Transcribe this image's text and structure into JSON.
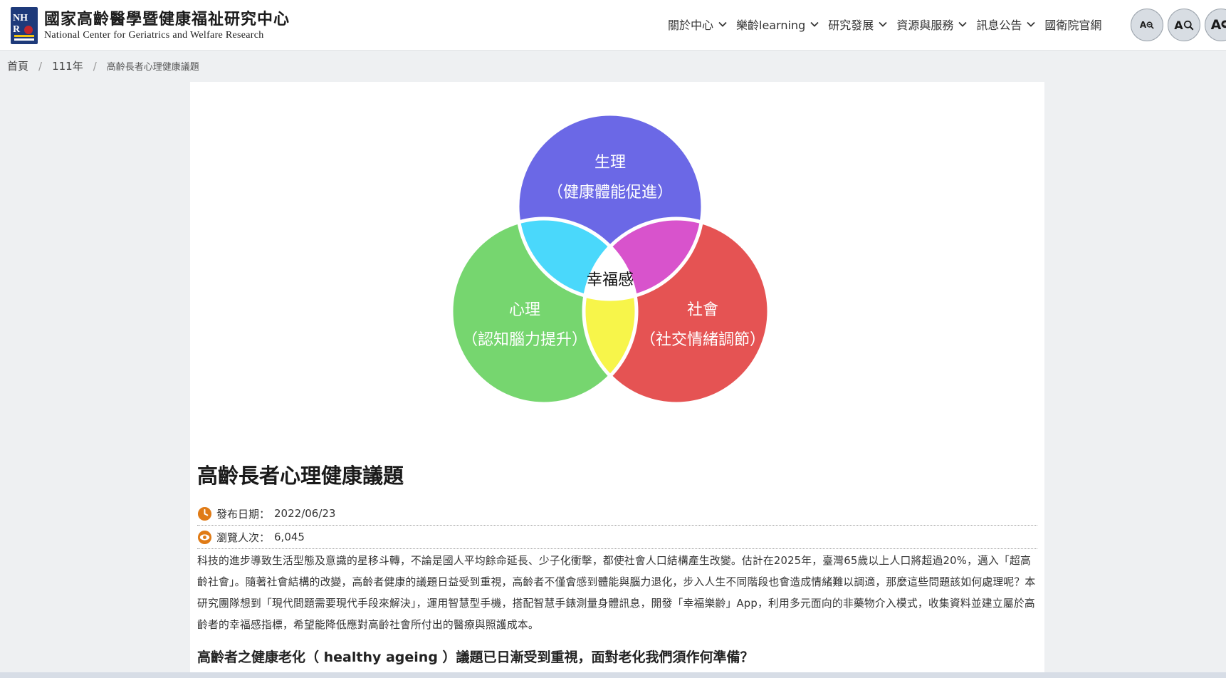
{
  "header": {
    "logo_cn": "國家高齡醫學暨健康福祉研究中心",
    "logo_en": "National Center for Geriatrics and Welfare Research",
    "nav": [
      {
        "label": "關於中心"
      },
      {
        "label": "樂齡learning"
      },
      {
        "label": "研究發展"
      },
      {
        "label": "資源與服務"
      },
      {
        "label": "訊息公告"
      },
      {
        "label": "國衛院官網"
      }
    ],
    "font_buttons": [
      {
        "label": "A",
        "icon": "zoom-out-icon"
      },
      {
        "label": "A",
        "icon": "search-icon"
      },
      {
        "label": "A",
        "icon": "zoom-in-icon"
      }
    ]
  },
  "breadcrumb": {
    "items": [
      "首頁",
      "111年",
      "高齡長者心理健康議題"
    ]
  },
  "venn": {
    "top_title": "生理",
    "top_sub": "（健康體能促進）",
    "left_title": "心理",
    "left_sub": "（認知腦力提升）",
    "right_title": "社會",
    "right_sub": "（社交情緒調節）",
    "center": "幸福感",
    "colors": {
      "top": "#6b68e6",
      "left": "#76d66f",
      "right": "#e55353",
      "top_left": "#4ad8fb",
      "top_right": "#d853cc",
      "left_right": "#f7f54a",
      "center": "#ffffff"
    }
  },
  "article": {
    "title": "高齡長者心理健康議題",
    "date_label": "發布日期：",
    "date_value": "2022/06/23",
    "views_label": "瀏覽人次：",
    "views_value": "6,045",
    "paragraph": "科技的進步導致生活型態及意識的星移斗轉，不論是國人平均餘命延長、少子化衝擊，都使社會人口結構產生改變。估計在2025年，臺灣65歲以上人口將超過20%，邁入「超高齡社會」。隨著社會結構的改變，高齡者健康的議題日益受到重視，高齡者不僅會感到體能與腦力退化，步入人生不同階段也會造成情緒難以調適，那麼這些問題該如何處理呢？本研究團隊想到「現代問題需要現代手段來解決」，運用智慧型手機，搭配智慧手錶測量身體訊息，開發「幸福樂齡」App，利用多元面向的非藥物介入模式，收集資料並建立屬於高齡者的幸福感指標，希望能降低應對高齡社會所付出的醫療與照護成本。",
    "subheading": "高齡者之健康老化（ healthy ageing ）議題已日漸受到重視，面對老化我們須作何準備？",
    "accent_color": "#e07b16"
  }
}
